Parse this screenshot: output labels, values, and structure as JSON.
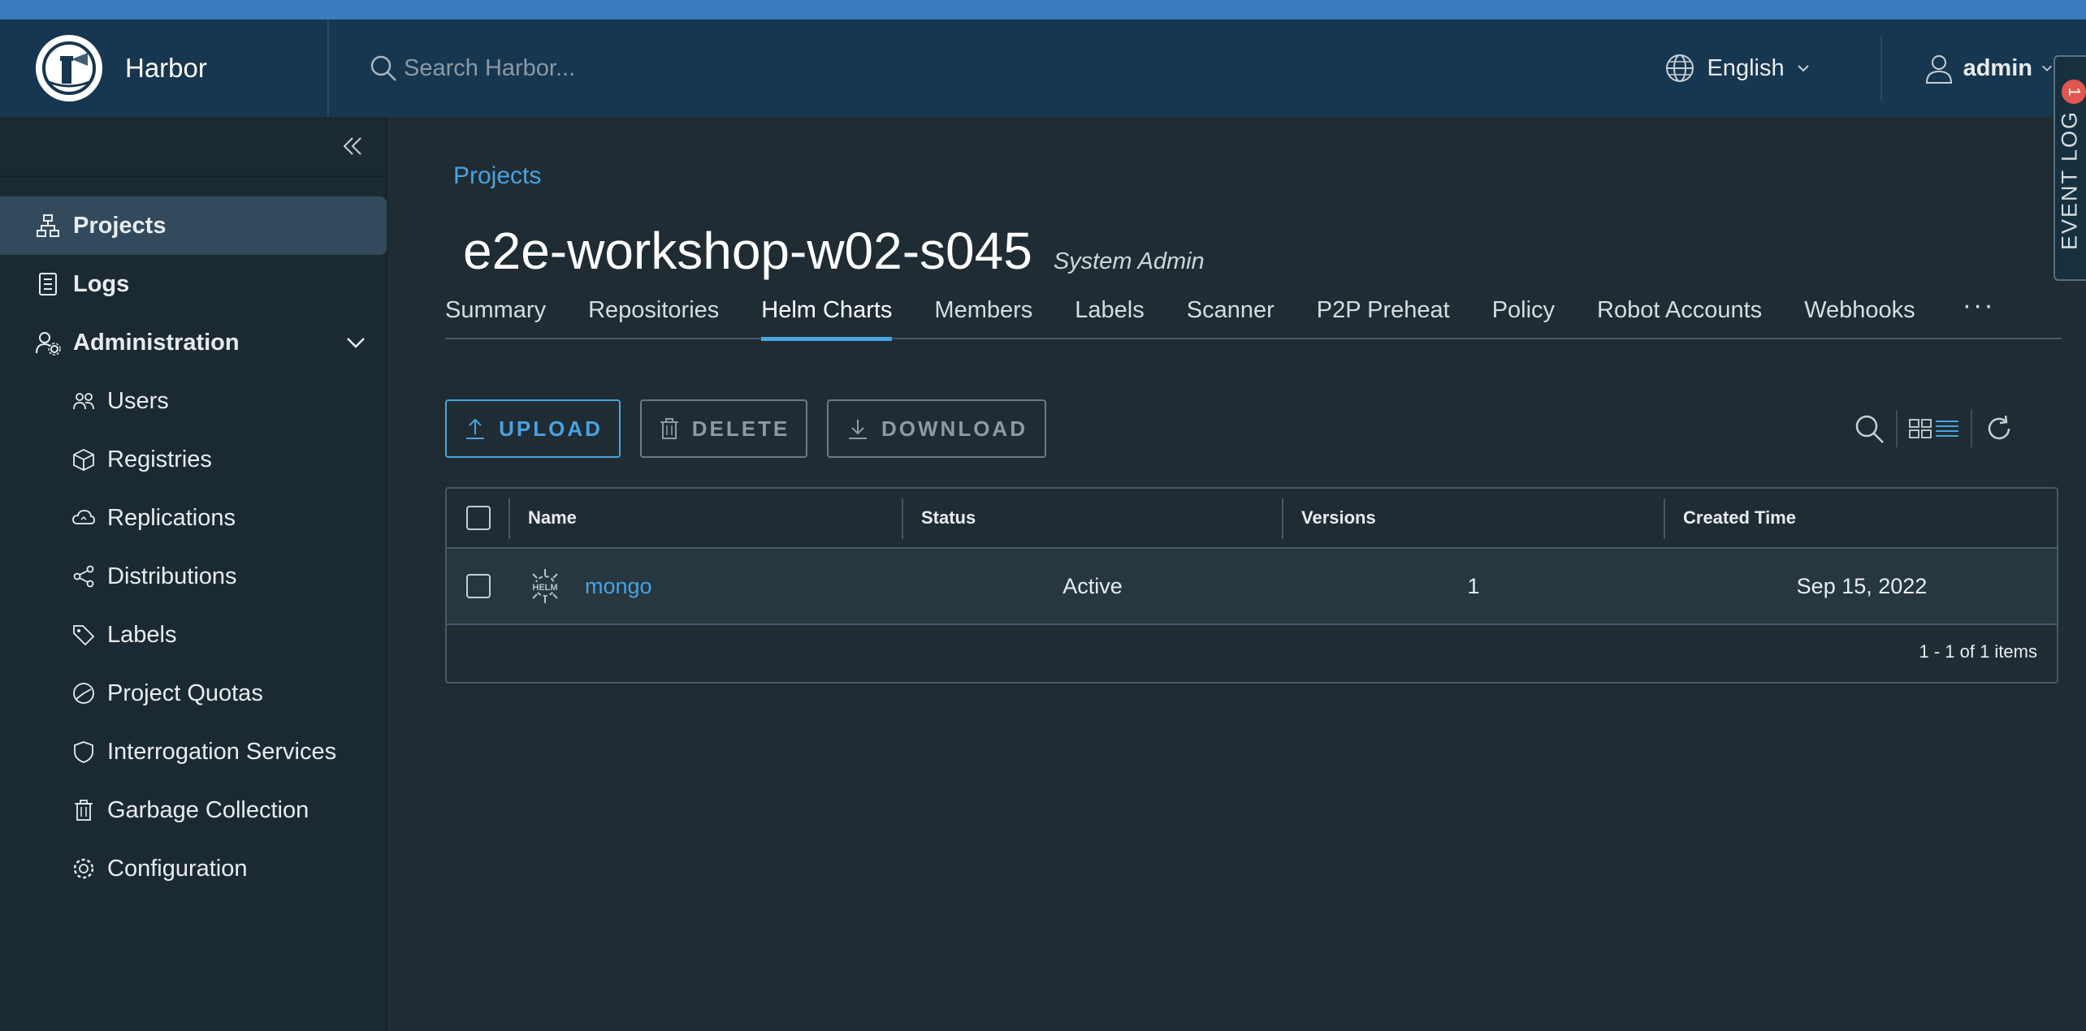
{
  "header": {
    "brand": "Harbor",
    "search_placeholder": "Search Harbor...",
    "language": "English",
    "user": "admin"
  },
  "sidebar": {
    "items": [
      {
        "label": "Projects"
      },
      {
        "label": "Logs"
      },
      {
        "label": "Administration"
      },
      {
        "label": "Users"
      },
      {
        "label": "Registries"
      },
      {
        "label": "Replications"
      },
      {
        "label": "Distributions"
      },
      {
        "label": "Labels"
      },
      {
        "label": "Project Quotas"
      },
      {
        "label": "Interrogation Services"
      },
      {
        "label": "Garbage Collection"
      },
      {
        "label": "Configuration"
      }
    ]
  },
  "main": {
    "breadcrumb": "Projects",
    "title": "e2e-workshop-w02-s045",
    "role": "System Admin",
    "tabs": [
      {
        "label": "Summary"
      },
      {
        "label": "Repositories"
      },
      {
        "label": "Helm Charts"
      },
      {
        "label": "Members"
      },
      {
        "label": "Labels"
      },
      {
        "label": "Scanner"
      },
      {
        "label": "P2P Preheat"
      },
      {
        "label": "Policy"
      },
      {
        "label": "Robot Accounts"
      },
      {
        "label": "Webhooks"
      }
    ],
    "more_tabs": "···",
    "buttons": {
      "upload": "UPLOAD",
      "delete": "DELETE",
      "download": "DOWNLOAD"
    }
  },
  "table": {
    "headers": [
      "Name",
      "Status",
      "Versions",
      "Created Time"
    ],
    "rows": [
      {
        "name": "mongo",
        "status": "Active",
        "versions": "1",
        "created": "Sep 15, 2022"
      }
    ],
    "footer": "1 - 1 of 1 items"
  },
  "event_log": {
    "label": "EVENT LOG",
    "count": "1"
  },
  "colors": {
    "accent": "#49a3e0",
    "header": "#17364f",
    "sidebar_active": "#324a5c",
    "badge": "#e0574e"
  }
}
